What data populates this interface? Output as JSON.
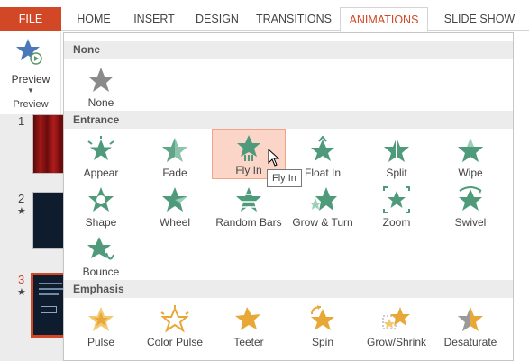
{
  "ribbon": {
    "tabs": {
      "file": "FILE",
      "home": "HOME",
      "insert": "INSERT",
      "design": "DESIGN",
      "transitions": "TRANSITIONS",
      "animations": "ANIMATIONS",
      "slideshow": "SLIDE SHOW"
    },
    "active_tab": "ANIMATIONS",
    "preview": {
      "label": "Preview",
      "group": "Preview"
    }
  },
  "thumbnails": [
    {
      "number": "1",
      "starred": false
    },
    {
      "number": "2",
      "starred": true
    },
    {
      "number": "3",
      "starred": true,
      "selected": true
    }
  ],
  "gallery": {
    "sections": {
      "none": "None",
      "entrance": "Entrance",
      "emphasis": "Emphasis"
    },
    "none_items": [
      "None"
    ],
    "entrance_items": [
      "Appear",
      "Fade",
      "Fly In",
      "Float In",
      "Split",
      "Wipe",
      "Shape",
      "Wheel",
      "Random Bars",
      "Grow & Turn",
      "Zoom",
      "Swivel",
      "Bounce"
    ],
    "emphasis_items": [
      "Pulse",
      "Color Pulse",
      "Teeter",
      "Spin",
      "Grow/Shrink",
      "Desaturate"
    ],
    "hovered": "Fly In",
    "tooltip": "Fly In"
  },
  "colors": {
    "accent": "#d24726",
    "entrance_green": "#4e9a7b",
    "emphasis_gold": "#e8a838",
    "none_gray": "#8a8a8a",
    "hover_fill": "#fbd6c8"
  }
}
